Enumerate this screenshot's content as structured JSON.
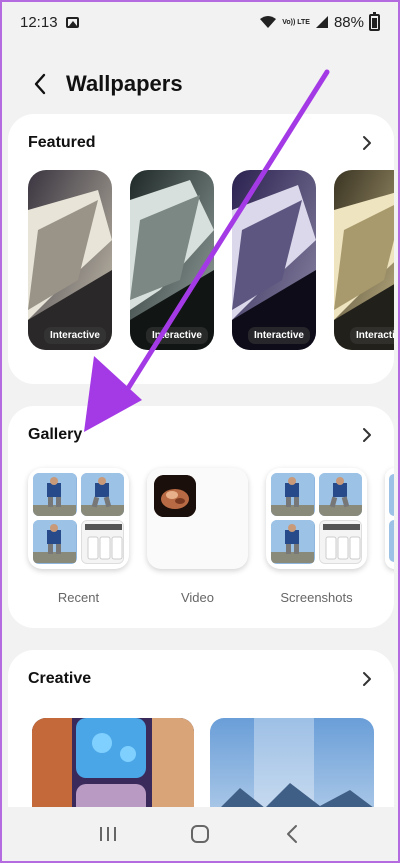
{
  "status": {
    "time": "12:13",
    "network": "Vo)) LTE",
    "battery": "88%"
  },
  "header": {
    "title": "Wallpapers"
  },
  "featured": {
    "title": "Featured",
    "items": [
      {
        "badge": "Interactive"
      },
      {
        "badge": "Interactive"
      },
      {
        "badge": "Interactive"
      },
      {
        "badge": "Interactive"
      }
    ]
  },
  "gallery": {
    "title": "Gallery",
    "items": [
      {
        "label": "Recent"
      },
      {
        "label": "Video"
      },
      {
        "label": "Screenshots"
      }
    ]
  },
  "creative": {
    "title": "Creative"
  },
  "colors": {
    "arrow": "#a43ae6",
    "border": "#b56be0"
  },
  "icons": [
    "back-arrow-icon",
    "chevron-right-icon",
    "recents-icon",
    "home-icon",
    "back-icon"
  ]
}
